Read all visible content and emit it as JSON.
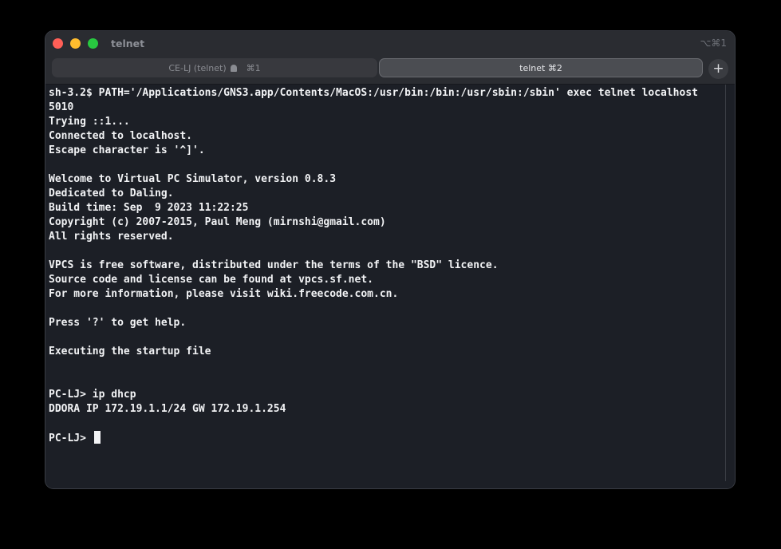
{
  "window": {
    "title": "telnet",
    "shortcut": "⌥⌘1"
  },
  "tabs": [
    {
      "label": "CE-LJ (telnet)",
      "shortcut": "⌘1",
      "active": false,
      "icon": "bell-icon"
    },
    {
      "label": "telnet ⌘2",
      "active": true
    }
  ],
  "new_tab_label": "+",
  "terminal": {
    "lines": [
      "sh-3.2$ PATH='/Applications/GNS3.app/Contents/MacOS:/usr/bin:/bin:/usr/sbin:/sbin' exec telnet localhost",
      "5010",
      "Trying ::1...",
      "Connected to localhost.",
      "Escape character is '^]'.",
      "",
      "Welcome to Virtual PC Simulator, version 0.8.3",
      "Dedicated to Daling.",
      "Build time: Sep  9 2023 11:22:25",
      "Copyright (c) 2007-2015, Paul Meng (mirnshi@gmail.com)",
      "All rights reserved.",
      "",
      "VPCS is free software, distributed under the terms of the \"BSD\" licence.",
      "Source code and license can be found at vpcs.sf.net.",
      "For more information, please visit wiki.freecode.com.cn.",
      "",
      "Press '?' to get help.",
      "",
      "Executing the startup file",
      "",
      "",
      "PC-LJ> ip dhcp",
      "DDORA IP 172.19.1.1/24 GW 172.19.1.254",
      "",
      "PC-LJ> "
    ]
  },
  "colors": {
    "background": "#1c1f26",
    "text": "#f2f3f5",
    "titlebar": "#2a2c31",
    "close": "#ff5f57",
    "minimize": "#febc2e",
    "maximize": "#28c840"
  }
}
